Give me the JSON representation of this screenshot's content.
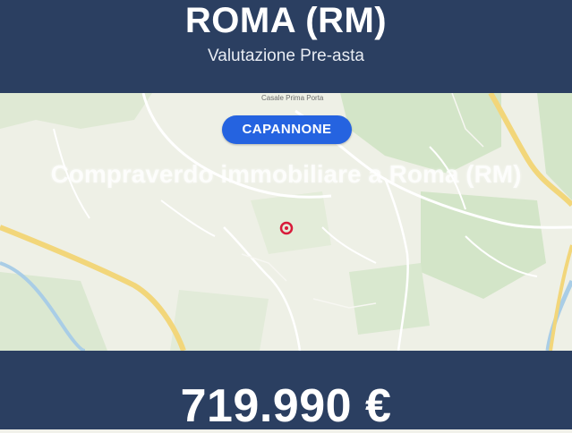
{
  "header": {
    "city": "ROMA (RM)",
    "subtitle": "Valutazione Pre-asta"
  },
  "map": {
    "place_label": "Casale Prima Porta",
    "badge": "CAPANNONE",
    "overlay_text": "Compraverdo immobiliare a Roma (RM)",
    "marker_icon": "location-marker-icon",
    "colors": {
      "header_bg": "#2b3f61",
      "badge_bg": "#2563e0",
      "marker": "#d81b3a",
      "major_road": "#f2d67a",
      "green_area": "#cfe3c3",
      "river": "#a9cde6"
    }
  },
  "footer": {
    "price": "719.990 €"
  }
}
